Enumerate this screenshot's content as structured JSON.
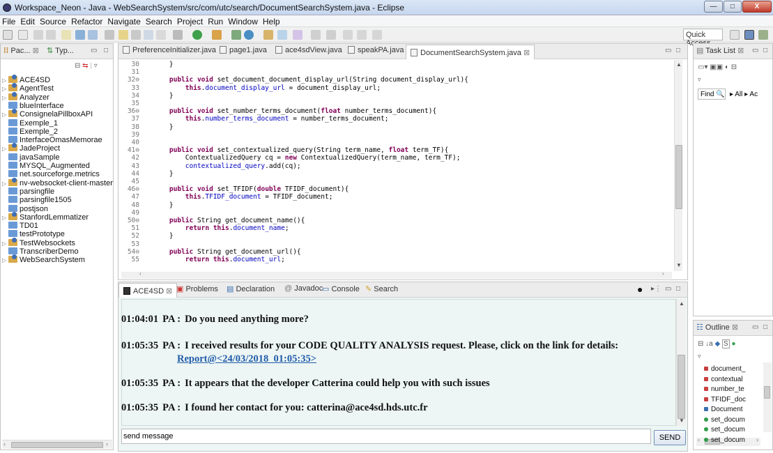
{
  "window": {
    "title": "Workspace_Neon - Java - WebSearchSystem/src/com/utc/search/DocumentSearchSystem.java - Eclipse",
    "min_label": "—",
    "max_label": "□",
    "close_label": "X"
  },
  "menu": [
    "File",
    "Edit",
    "Source",
    "Refactor",
    "Navigate",
    "Search",
    "Project",
    "Run",
    "Window",
    "Help"
  ],
  "toolbar": {
    "quick_access": "Quick Access"
  },
  "left_panel": {
    "tabs": [
      "Pac...",
      "Typ..."
    ],
    "items": [
      {
        "label": "ACE4SD",
        "type": "proj"
      },
      {
        "label": "AgentTest",
        "type": "proj"
      },
      {
        "label": "Analyzer",
        "type": "proj"
      },
      {
        "label": "blueInterface",
        "type": "folder"
      },
      {
        "label": "ConsignelaPillboxAPI",
        "type": "proj"
      },
      {
        "label": "Exemple_1",
        "type": "folder"
      },
      {
        "label": "Exemple_2",
        "type": "folder"
      },
      {
        "label": "InterfaceOmasMemorae",
        "type": "folder"
      },
      {
        "label": "JadeProject",
        "type": "proj"
      },
      {
        "label": "javaSample",
        "type": "folder"
      },
      {
        "label": "MYSQL_Augmented",
        "type": "folder"
      },
      {
        "label": "net.sourceforge.metrics",
        "type": "folder"
      },
      {
        "label": "nv-websocket-client-master",
        "type": "proj"
      },
      {
        "label": "parsingfile",
        "type": "folder"
      },
      {
        "label": "parsingfile1505",
        "type": "folder"
      },
      {
        "label": "postjson",
        "type": "folder"
      },
      {
        "label": "StanfordLemmatizer",
        "type": "proj"
      },
      {
        "label": "TD01",
        "type": "folder"
      },
      {
        "label": "testPrototype",
        "type": "folder"
      },
      {
        "label": "TestWebsockets",
        "type": "proj"
      },
      {
        "label": "TranscriberDemo",
        "type": "folder"
      },
      {
        "label": "WebSearchSystem",
        "type": "proj"
      }
    ]
  },
  "editor": {
    "tabs": [
      "PreferenceInitializer.java",
      "page1.java",
      "ace4sdView.java",
      "speakPA.java",
      "DocumentSearchSystem.java"
    ],
    "lines": [
      {
        "n": "30",
        "t": "    }"
      },
      {
        "n": "31",
        "t": ""
      },
      {
        "n": "32⊖",
        "t": "    public void set_document_document_display_url(String document_display_url){"
      },
      {
        "n": "33",
        "t": "        this.document_display_url = document_display_url;"
      },
      {
        "n": "34",
        "t": "    }"
      },
      {
        "n": "35",
        "t": ""
      },
      {
        "n": "36⊖",
        "t": "    public void set_number_terms_document(float number_terms_document){"
      },
      {
        "n": "37",
        "t": "        this.number_terms_document = number_terms_document;"
      },
      {
        "n": "38",
        "t": "    }"
      },
      {
        "n": "39",
        "t": ""
      },
      {
        "n": "40",
        "t": ""
      },
      {
        "n": "41⊖",
        "t": "    public void set_contextualized_query(String term_name, float term_TF){"
      },
      {
        "n": "42",
        "t": "        ContextualizedQuery cq = new ContextualizedQuery(term_name, term_TF);"
      },
      {
        "n": "43",
        "t": "        contextualized_query.add(cq);"
      },
      {
        "n": "44",
        "t": "    }"
      },
      {
        "n": "45",
        "t": ""
      },
      {
        "n": "46⊖",
        "t": "    public void set_TFIDF(double TFIDF_document){"
      },
      {
        "n": "47",
        "t": "        this.TFIDF_document = TFIDF_document;"
      },
      {
        "n": "48",
        "t": "    }"
      },
      {
        "n": "49",
        "t": ""
      },
      {
        "n": "50⊖",
        "t": "    public String get_document_name(){"
      },
      {
        "n": "51",
        "t": "        return this.document_name;"
      },
      {
        "n": "52",
        "t": "    }"
      },
      {
        "n": "53",
        "t": ""
      },
      {
        "n": "54⊖",
        "t": "    public String get_document_url(){"
      },
      {
        "n": "55",
        "t": "        return this.document_url;"
      }
    ]
  },
  "bottom_panel": {
    "tabs": [
      "ACE4SD",
      "Problems",
      "Declaration",
      "Javadoc",
      "Console",
      "Search"
    ],
    "messages": [
      {
        "time": "01:04:01",
        "speaker": "PA :",
        "text": "Do you need anything more?"
      },
      {
        "time": "01:05:35",
        "speaker": "PA :",
        "text": "I received results for your CODE QUALITY ANALYSIS request. Please, click on the link for details:",
        "link": "Report@<24/03/2018_01:05:35>"
      },
      {
        "time": "01:05:35",
        "speaker": "PA :",
        "text": "It appears that the developer Catterina could help you with such issues"
      },
      {
        "time": "01:05:35",
        "speaker": "PA :",
        "text": "I found her contact for you: catterina@ace4sd.hds.utc.fr"
      }
    ],
    "input_value": "send message",
    "send_label": "SEND"
  },
  "task_list": {
    "tab": "Task List",
    "find_label": "Find",
    "all_label": "All",
    "activate_label": "Ac"
  },
  "outline": {
    "tab": "Outline",
    "items": [
      {
        "label": "document_",
        "color": "#c94040"
      },
      {
        "label": "contextual",
        "color": "#c94040"
      },
      {
        "label": "number_te",
        "color": "#c94040"
      },
      {
        "label": "TFIDF_doc",
        "color": "#c94040"
      },
      {
        "label": "Document",
        "color": "#3a6fb0"
      },
      {
        "label": "set_docum",
        "color": "#2e9d4a"
      },
      {
        "label": "set_docum",
        "color": "#2e9d4a"
      },
      {
        "label": "set_docum",
        "color": "#2e9d4a"
      }
    ]
  }
}
